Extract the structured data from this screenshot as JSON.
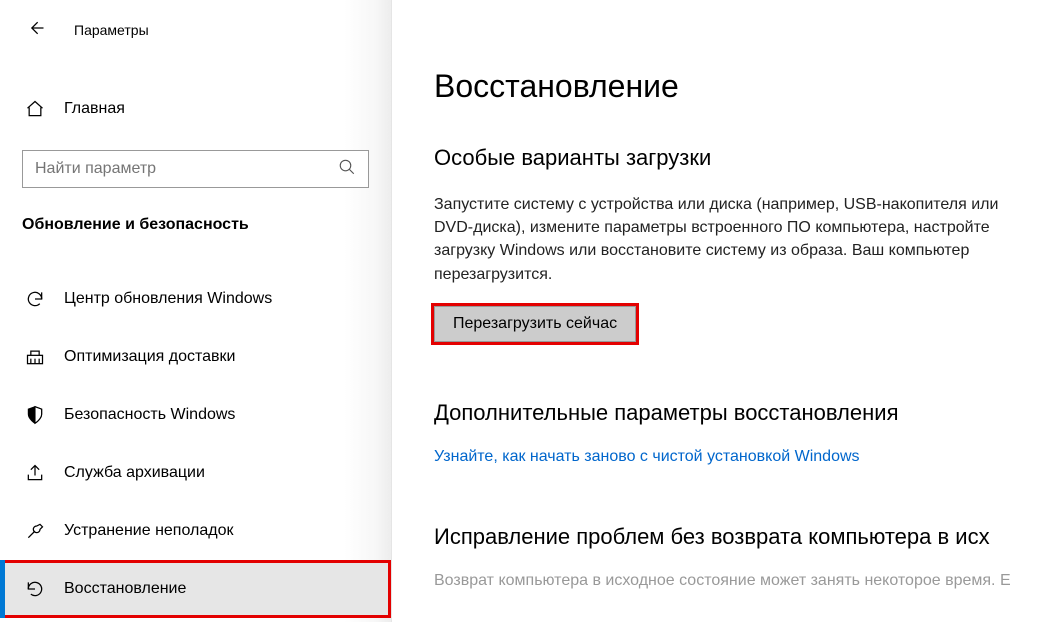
{
  "header": {
    "title": "Параметры"
  },
  "sidebar": {
    "home_label": "Главная",
    "search_placeholder": "Найти параметр",
    "section_title": "Обновление и безопасность",
    "items": [
      {
        "label": "Центр обновления Windows"
      },
      {
        "label": "Оптимизация доставки"
      },
      {
        "label": "Безопасность Windows"
      },
      {
        "label": "Служба архивации"
      },
      {
        "label": "Устранение неполадок"
      },
      {
        "label": "Восстановление"
      }
    ]
  },
  "main": {
    "page_title": "Восстановление",
    "advanced_startup": {
      "heading": "Особые варианты загрузки",
      "description": "Запустите систему с устройства или диска (например, USB-накопителя или DVD-диска), измените параметры встроенного ПО компьютера, настройте загрузку Windows или восстановите систему из образа. Ваш компьютер перезагрузится.",
      "button": "Перезагрузить сейчас"
    },
    "more_options": {
      "heading": "Дополнительные параметры восстановления",
      "link": "Узнайте, как начать заново с чистой установкой Windows"
    },
    "fix_problems": {
      "heading": "Исправление проблем без возврата компьютера в исх",
      "partial": "Возврат компьютера в исходное состояние может занять некоторое время. Е"
    }
  }
}
